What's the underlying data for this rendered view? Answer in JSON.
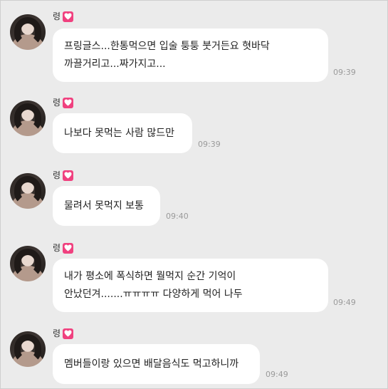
{
  "messages": [
    {
      "sender": "령",
      "lines": [
        "프링글스...한통먹으면 입술 퉁퉁 붓거든요 혓바닥",
        "까끌거리고...짜가지고..."
      ],
      "time": "09:39"
    },
    {
      "sender": "령",
      "lines": [
        "나보다 못먹는 사람 많드만"
      ],
      "time": "09:39"
    },
    {
      "sender": "령",
      "lines": [
        "물려서 못먹지 보통"
      ],
      "time": "09:40"
    },
    {
      "sender": "령",
      "lines": [
        "내가 평소에 폭식하면 뭘먹지 순간 기억이",
        "안났던겨.......ㅠㅠㅠㅠ 다양하게 먹어 나두"
      ],
      "time": "09:49"
    },
    {
      "sender": "령",
      "lines": [
        "멤버들이랑 있으면 배달음식도 먹고하니까"
      ],
      "time": "09:49"
    }
  ],
  "icons": {
    "badge": "heart-icon",
    "badge_color": "#f0417f"
  }
}
